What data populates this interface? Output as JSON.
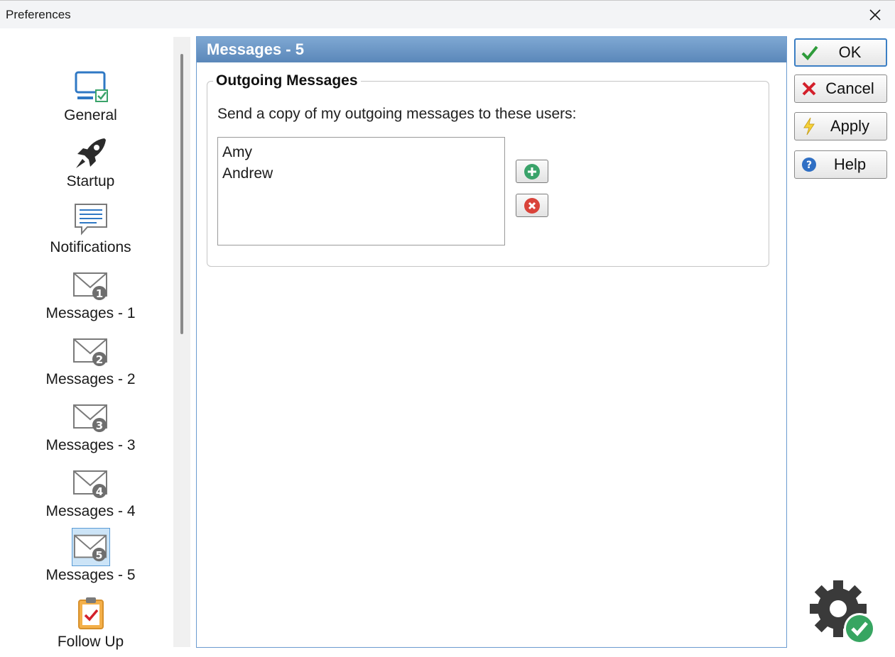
{
  "window": {
    "title": "Preferences"
  },
  "nav": {
    "items": [
      {
        "label": "General",
        "icon": "monitor-check-icon"
      },
      {
        "label": "Startup",
        "icon": "rocket-icon"
      },
      {
        "label": "Notifications",
        "icon": "speech-bubble-icon"
      },
      {
        "label": "Messages - 1",
        "icon": "envelope-1-icon"
      },
      {
        "label": "Messages - 2",
        "icon": "envelope-2-icon"
      },
      {
        "label": "Messages - 3",
        "icon": "envelope-3-icon"
      },
      {
        "label": "Messages - 4",
        "icon": "envelope-4-icon"
      },
      {
        "label": "Messages - 5",
        "icon": "envelope-5-icon",
        "selected": true
      },
      {
        "label": "Follow Up",
        "icon": "clipboard-check-icon"
      }
    ]
  },
  "panel": {
    "title": "Messages - 5",
    "group": {
      "title": "Outgoing Messages",
      "description": "Send a copy of my outgoing messages to these users:",
      "users": [
        "Amy",
        "Andrew"
      ]
    }
  },
  "actions": {
    "ok": "OK",
    "cancel": "Cancel",
    "apply": "Apply",
    "help": "Help"
  },
  "colors": {
    "header_blue": "#5a87b9",
    "selection_blue": "#cce4f7",
    "ok_green": "#2e9b3a",
    "cancel_red": "#d3202b",
    "add_green": "#3aa36a",
    "remove_red": "#d9433a"
  }
}
